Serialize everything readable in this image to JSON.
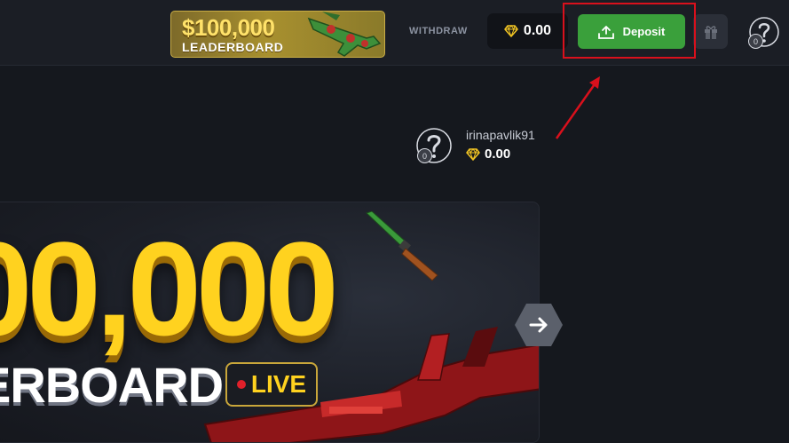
{
  "header": {
    "promo": {
      "amount": "$100,000",
      "title": "LEADERBOARD"
    },
    "withdraw_label": "WITHDRAW",
    "balance": {
      "icon": "diamond-icon",
      "value": "0.00"
    },
    "deposit": {
      "icon": "download-tray-icon",
      "label": "Deposit"
    },
    "gift": {
      "icon": "gift-icon"
    },
    "avatar": {
      "icon": "question-mark-icon",
      "level": "0"
    }
  },
  "user": {
    "avatar_level": "0",
    "username": "irinapavlik91",
    "balance": "0.00"
  },
  "banner": {
    "amount": "00,000",
    "title": "ERBOARD",
    "live_label": "LIVE"
  },
  "colors": {
    "background": "#15181e",
    "header": "#1b1e25",
    "deposit_green": "#3aa03b",
    "gold": "#ffd21f",
    "annotation_red": "#d9101c"
  }
}
